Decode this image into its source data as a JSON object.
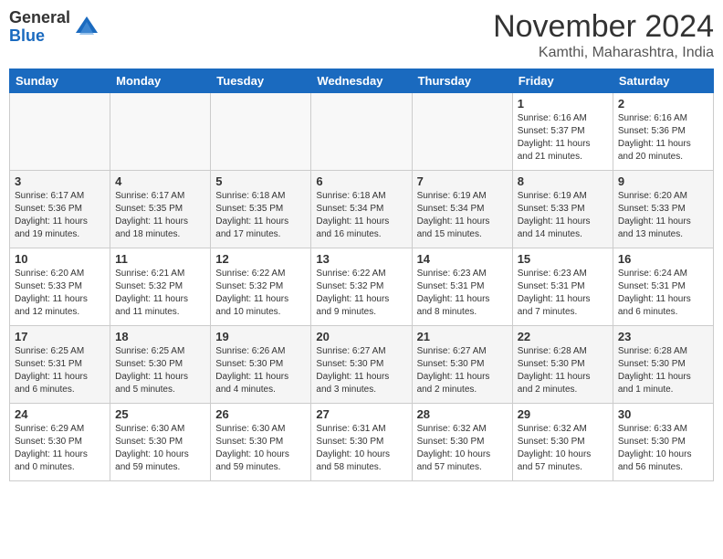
{
  "logo": {
    "general": "General",
    "blue": "Blue"
  },
  "title": "November 2024",
  "location": "Kamthi, Maharashtra, India",
  "days_header": [
    "Sunday",
    "Monday",
    "Tuesday",
    "Wednesday",
    "Thursday",
    "Friday",
    "Saturday"
  ],
  "weeks": [
    {
      "row_class": "row-odd",
      "days": [
        {
          "num": "",
          "empty": true
        },
        {
          "num": "",
          "empty": true
        },
        {
          "num": "",
          "empty": true
        },
        {
          "num": "",
          "empty": true
        },
        {
          "num": "",
          "empty": true
        },
        {
          "num": "1",
          "sunrise": "Sunrise: 6:16 AM",
          "sunset": "Sunset: 5:37 PM",
          "daylight": "Daylight: 11 hours and 21 minutes."
        },
        {
          "num": "2",
          "sunrise": "Sunrise: 6:16 AM",
          "sunset": "Sunset: 5:36 PM",
          "daylight": "Daylight: 11 hours and 20 minutes."
        }
      ]
    },
    {
      "row_class": "row-even",
      "days": [
        {
          "num": "3",
          "sunrise": "Sunrise: 6:17 AM",
          "sunset": "Sunset: 5:36 PM",
          "daylight": "Daylight: 11 hours and 19 minutes."
        },
        {
          "num": "4",
          "sunrise": "Sunrise: 6:17 AM",
          "sunset": "Sunset: 5:35 PM",
          "daylight": "Daylight: 11 hours and 18 minutes."
        },
        {
          "num": "5",
          "sunrise": "Sunrise: 6:18 AM",
          "sunset": "Sunset: 5:35 PM",
          "daylight": "Daylight: 11 hours and 17 minutes."
        },
        {
          "num": "6",
          "sunrise": "Sunrise: 6:18 AM",
          "sunset": "Sunset: 5:34 PM",
          "daylight": "Daylight: 11 hours and 16 minutes."
        },
        {
          "num": "7",
          "sunrise": "Sunrise: 6:19 AM",
          "sunset": "Sunset: 5:34 PM",
          "daylight": "Daylight: 11 hours and 15 minutes."
        },
        {
          "num": "8",
          "sunrise": "Sunrise: 6:19 AM",
          "sunset": "Sunset: 5:33 PM",
          "daylight": "Daylight: 11 hours and 14 minutes."
        },
        {
          "num": "9",
          "sunrise": "Sunrise: 6:20 AM",
          "sunset": "Sunset: 5:33 PM",
          "daylight": "Daylight: 11 hours and 13 minutes."
        }
      ]
    },
    {
      "row_class": "row-odd",
      "days": [
        {
          "num": "10",
          "sunrise": "Sunrise: 6:20 AM",
          "sunset": "Sunset: 5:33 PM",
          "daylight": "Daylight: 11 hours and 12 minutes."
        },
        {
          "num": "11",
          "sunrise": "Sunrise: 6:21 AM",
          "sunset": "Sunset: 5:32 PM",
          "daylight": "Daylight: 11 hours and 11 minutes."
        },
        {
          "num": "12",
          "sunrise": "Sunrise: 6:22 AM",
          "sunset": "Sunset: 5:32 PM",
          "daylight": "Daylight: 11 hours and 10 minutes."
        },
        {
          "num": "13",
          "sunrise": "Sunrise: 6:22 AM",
          "sunset": "Sunset: 5:32 PM",
          "daylight": "Daylight: 11 hours and 9 minutes."
        },
        {
          "num": "14",
          "sunrise": "Sunrise: 6:23 AM",
          "sunset": "Sunset: 5:31 PM",
          "daylight": "Daylight: 11 hours and 8 minutes."
        },
        {
          "num": "15",
          "sunrise": "Sunrise: 6:23 AM",
          "sunset": "Sunset: 5:31 PM",
          "daylight": "Daylight: 11 hours and 7 minutes."
        },
        {
          "num": "16",
          "sunrise": "Sunrise: 6:24 AM",
          "sunset": "Sunset: 5:31 PM",
          "daylight": "Daylight: 11 hours and 6 minutes."
        }
      ]
    },
    {
      "row_class": "row-even",
      "days": [
        {
          "num": "17",
          "sunrise": "Sunrise: 6:25 AM",
          "sunset": "Sunset: 5:31 PM",
          "daylight": "Daylight: 11 hours and 6 minutes."
        },
        {
          "num": "18",
          "sunrise": "Sunrise: 6:25 AM",
          "sunset": "Sunset: 5:30 PM",
          "daylight": "Daylight: 11 hours and 5 minutes."
        },
        {
          "num": "19",
          "sunrise": "Sunrise: 6:26 AM",
          "sunset": "Sunset: 5:30 PM",
          "daylight": "Daylight: 11 hours and 4 minutes."
        },
        {
          "num": "20",
          "sunrise": "Sunrise: 6:27 AM",
          "sunset": "Sunset: 5:30 PM",
          "daylight": "Daylight: 11 hours and 3 minutes."
        },
        {
          "num": "21",
          "sunrise": "Sunrise: 6:27 AM",
          "sunset": "Sunset: 5:30 PM",
          "daylight": "Daylight: 11 hours and 2 minutes."
        },
        {
          "num": "22",
          "sunrise": "Sunrise: 6:28 AM",
          "sunset": "Sunset: 5:30 PM",
          "daylight": "Daylight: 11 hours and 2 minutes."
        },
        {
          "num": "23",
          "sunrise": "Sunrise: 6:28 AM",
          "sunset": "Sunset: 5:30 PM",
          "daylight": "Daylight: 11 hours and 1 minute."
        }
      ]
    },
    {
      "row_class": "row-odd",
      "days": [
        {
          "num": "24",
          "sunrise": "Sunrise: 6:29 AM",
          "sunset": "Sunset: 5:30 PM",
          "daylight": "Daylight: 11 hours and 0 minutes."
        },
        {
          "num": "25",
          "sunrise": "Sunrise: 6:30 AM",
          "sunset": "Sunset: 5:30 PM",
          "daylight": "Daylight: 10 hours and 59 minutes."
        },
        {
          "num": "26",
          "sunrise": "Sunrise: 6:30 AM",
          "sunset": "Sunset: 5:30 PM",
          "daylight": "Daylight: 10 hours and 59 minutes."
        },
        {
          "num": "27",
          "sunrise": "Sunrise: 6:31 AM",
          "sunset": "Sunset: 5:30 PM",
          "daylight": "Daylight: 10 hours and 58 minutes."
        },
        {
          "num": "28",
          "sunrise": "Sunrise: 6:32 AM",
          "sunset": "Sunset: 5:30 PM",
          "daylight": "Daylight: 10 hours and 57 minutes."
        },
        {
          "num": "29",
          "sunrise": "Sunrise: 6:32 AM",
          "sunset": "Sunset: 5:30 PM",
          "daylight": "Daylight: 10 hours and 57 minutes."
        },
        {
          "num": "30",
          "sunrise": "Sunrise: 6:33 AM",
          "sunset": "Sunset: 5:30 PM",
          "daylight": "Daylight: 10 hours and 56 minutes."
        }
      ]
    }
  ]
}
